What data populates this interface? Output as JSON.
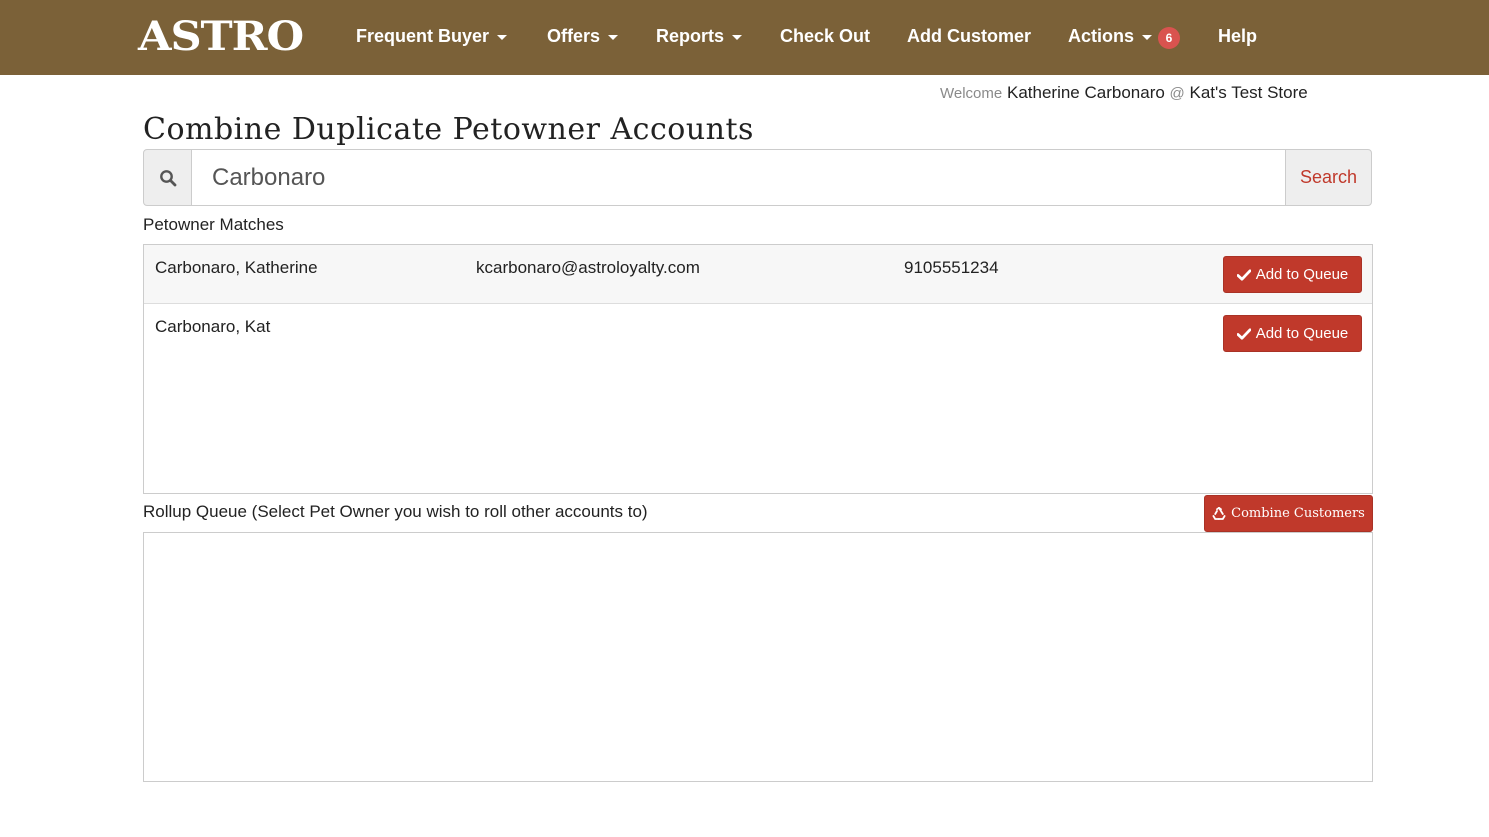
{
  "nav": {
    "brand": "ASTRO",
    "items": [
      {
        "label": "Frequent Buyer",
        "dropdown": true
      },
      {
        "label": "Offers",
        "dropdown": true
      },
      {
        "label": "Reports",
        "dropdown": true
      },
      {
        "label": "Check Out",
        "dropdown": false
      },
      {
        "label": "Add Customer",
        "dropdown": false
      },
      {
        "label": "Actions",
        "dropdown": true,
        "badge": "6"
      },
      {
        "label": "Help",
        "dropdown": false
      }
    ],
    "background": "#7b6138"
  },
  "welcome": {
    "prefix": "Welcome",
    "user": "Katherine Carbonaro",
    "at": "@",
    "store": "Kat's Test Store"
  },
  "page": {
    "title": "Combine Duplicate Petowner Accounts"
  },
  "search": {
    "value": "Carbonaro",
    "button_label": "Search",
    "icon": "search-icon"
  },
  "matches": {
    "label": "Petowner Matches",
    "rows": [
      {
        "name": "Carbonaro, Katherine",
        "email": "kcarbonaro@astroloyalty.com",
        "phone": "9105551234",
        "button_label": "Add to Queue"
      },
      {
        "name": "Carbonaro, Kat",
        "email": "",
        "phone": "",
        "button_label": "Add to Queue"
      }
    ]
  },
  "queue": {
    "label": "Rollup Queue (Select Pet Owner you wish to roll other accounts to)",
    "combine_label": "Combine Customers"
  },
  "colors": {
    "accent": "#c0392b",
    "badge": "#d9534f"
  }
}
